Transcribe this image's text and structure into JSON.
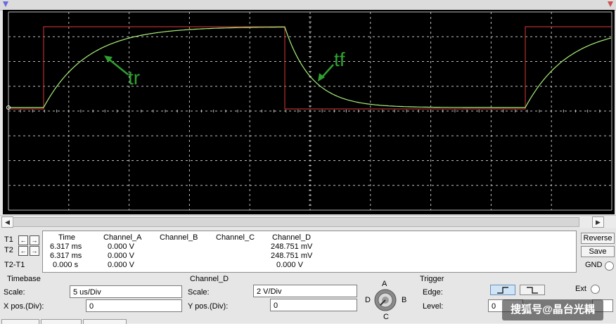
{
  "scope": {
    "h_divisions": 10,
    "v_divisions": 8,
    "annotations": [
      {
        "text": "tr",
        "color": "#2fa030"
      },
      {
        "text": "tf",
        "color": "#2fa030"
      }
    ],
    "colors": {
      "background": "#000000",
      "grid": "#bdbdbd",
      "square_wave": "#b53030",
      "response": "#a9f07a",
      "annotation": "#2fa030"
    }
  },
  "readout": {
    "headers": [
      "Time",
      "Channel_A",
      "Channel_B",
      "Channel_C",
      "Channel_D"
    ],
    "rows": [
      {
        "label": "T1",
        "time": "6.317 ms",
        "a": "0.000 V",
        "b": "",
        "c": "",
        "d": "248.751 mV"
      },
      {
        "label": "T2",
        "time": "6.317 ms",
        "a": "0.000 V",
        "b": "",
        "c": "",
        "d": "248.751 mV"
      },
      {
        "label": "T2-T1",
        "time": "0.000 s",
        "a": "0.000 V",
        "b": "",
        "c": "",
        "d": "0.000 V"
      }
    ]
  },
  "buttons": {
    "reverse": "Reverse",
    "save": "Save",
    "gnd": "GND"
  },
  "timebase": {
    "title": "Timebase",
    "scale_label": "Scale:",
    "scale_value": "5 us/Div",
    "xpos_label": "X pos.(Div):",
    "xpos_value": "0"
  },
  "channel_d": {
    "title": "Channel_D",
    "scale_label": "Scale:",
    "scale_value": "2  V/Div",
    "ypos_label": "Y pos.(Div):",
    "ypos_value": "0"
  },
  "selector": {
    "a": "A",
    "b": "B",
    "c": "C",
    "d": "D"
  },
  "trigger": {
    "title": "Trigger",
    "edge_label": "Edge:",
    "level_label": "Level:",
    "level_value": "0",
    "ext_label": "Ext"
  },
  "watermark": "搜狐号@晶台光耦"
}
